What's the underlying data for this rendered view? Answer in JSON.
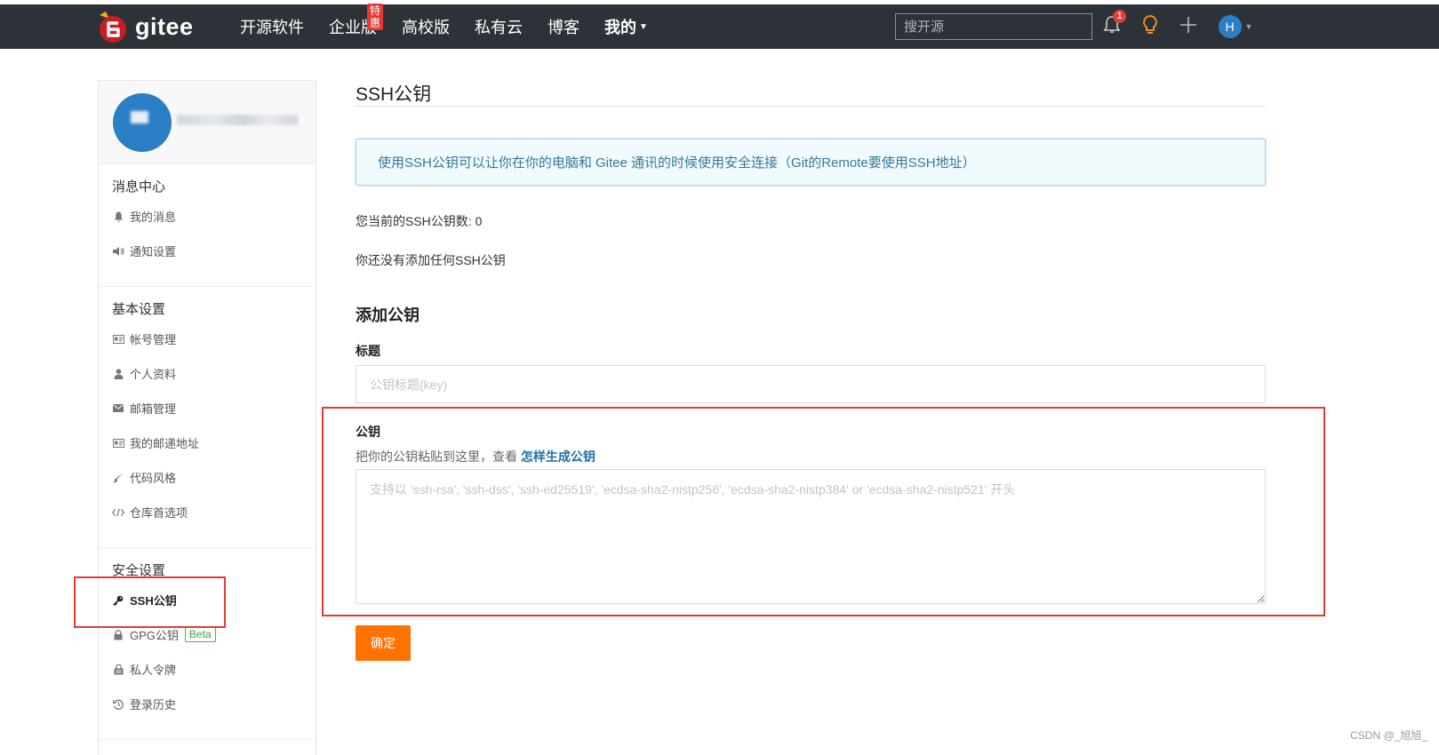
{
  "topbar": {
    "brand": "gitee",
    "nav": [
      {
        "label": "开源软件"
      },
      {
        "label": "企业版",
        "badge": "特惠"
      },
      {
        "label": "高校版"
      },
      {
        "label": "私有云"
      },
      {
        "label": "博客"
      },
      {
        "label": "我的"
      }
    ],
    "search_placeholder": "搜开源",
    "notification_count": "1",
    "avatar_letter": "H",
    "icons": [
      "bell-icon",
      "lightbulb-icon",
      "plus-icon",
      "chevron-down-icon"
    ]
  },
  "sidebar": {
    "sections": [
      {
        "title": "消息中心",
        "items": [
          {
            "label": "我的消息",
            "icon": "bell-icon"
          },
          {
            "label": "通知设置",
            "icon": "volume-icon"
          }
        ]
      },
      {
        "title": "基本设置",
        "items": [
          {
            "label": "帐号管理",
            "icon": "id-card-icon"
          },
          {
            "label": "个人资料",
            "icon": "user-icon"
          },
          {
            "label": "邮箱管理",
            "icon": "envelope-icon"
          },
          {
            "label": "我的邮递地址",
            "icon": "address-card-icon"
          },
          {
            "label": "代码风格",
            "icon": "brush-icon"
          },
          {
            "label": "仓库首选项",
            "icon": "code-icon"
          }
        ]
      },
      {
        "title": "安全设置",
        "items": [
          {
            "label": "SSH公钥",
            "icon": "key-icon",
            "active": true
          },
          {
            "label": "GPG公钥",
            "icon": "lock-icon",
            "badge": "Beta"
          },
          {
            "label": "私人令牌",
            "icon": "token-icon"
          },
          {
            "label": "登录历史",
            "icon": "history-icon"
          }
        ]
      }
    ]
  },
  "main": {
    "title": "SSH公钥",
    "info": "使用SSH公钥可以让你在你的电脑和 Gitee 通讯的时候使用安全连接（Git的Remote要使用SSH地址）",
    "count_text": "您当前的SSH公钥数: 0",
    "empty_text": "你还没有添加任何SSH公钥",
    "add_title": "添加公钥",
    "title_label": "标题",
    "title_placeholder": "公钥标题(key)",
    "key_label": "公钥",
    "key_hint": "把你的公钥粘贴到这里，查看 ",
    "key_hint_link": "怎样生成公钥",
    "key_placeholder": "支持以 'ssh-rsa', 'ssh-dss', 'ssh-ed25519', 'ecdsa-sha2-nistp256', 'ecdsa-sha2-nistp384' or 'ecdsa-sha2-nistp521' 开头",
    "submit_label": "确定"
  },
  "watermark": "CSDN @_旭旭_",
  "colors": {
    "topbar": "#2d3239",
    "accent_button": "#fe7300",
    "annotation": "#e53935",
    "info_text": "#337a97",
    "link": "#1f6fa5"
  }
}
